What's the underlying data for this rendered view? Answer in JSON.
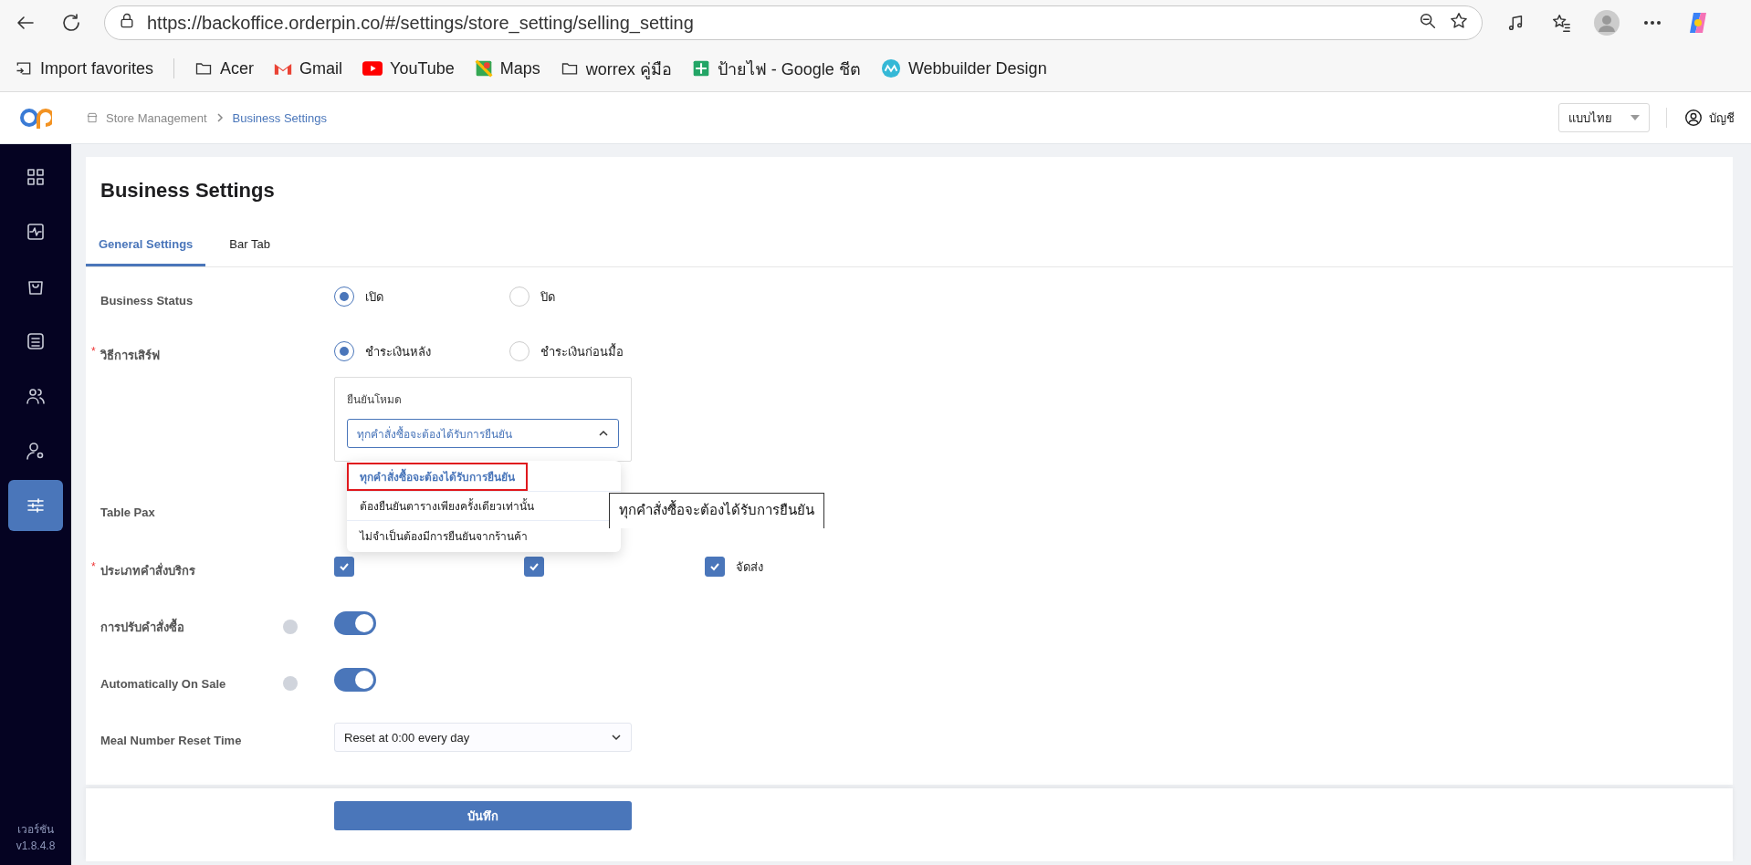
{
  "browser": {
    "url": "https://backoffice.orderpin.co/#/settings/store_setting/selling_setting",
    "bookmarks": [
      {
        "label": "Import favorites",
        "kind": "import"
      },
      {
        "label": "Acer",
        "kind": "folder"
      },
      {
        "label": "Gmail",
        "kind": "mail"
      },
      {
        "label": "YouTube",
        "kind": "video"
      },
      {
        "label": "Maps",
        "kind": "map"
      },
      {
        "label": "worrex คู่มือ",
        "kind": "folder"
      },
      {
        "label": "ป้ายไฟ - Google ชีต",
        "kind": "sheet"
      },
      {
        "label": "Webbuilder Design",
        "kind": "wave"
      }
    ]
  },
  "header": {
    "breadcrumb": [
      {
        "label": "Store Management",
        "selected": false
      },
      {
        "label": "Business Settings",
        "selected": true
      }
    ],
    "language": "แบบไทย",
    "account": "บัญชี"
  },
  "sidebar": {
    "items": [
      {
        "kind": "grid",
        "selected": false
      },
      {
        "kind": "pulse",
        "selected": false
      },
      {
        "kind": "bag",
        "selected": false
      },
      {
        "kind": "store",
        "selected": false
      },
      {
        "kind": "users",
        "selected": false
      },
      {
        "kind": "user-gear",
        "selected": false
      },
      {
        "kind": "sliders",
        "selected": true
      }
    ],
    "version_label": "เวอร์ชัน",
    "version": "v1.8.4.8"
  },
  "page": {
    "title": "Business Settings",
    "tabs": [
      {
        "label": "General Settings",
        "selected": true
      },
      {
        "label": "Bar Tab",
        "selected": false
      }
    ]
  },
  "form": [
    {
      "kind": "radio",
      "label": "Business Status",
      "options": [
        {
          "label": "เปิด",
          "selected": true
        },
        {
          "label": "ปิด",
          "selected": false
        }
      ]
    },
    {
      "kind": "radio",
      "label": "วิธีการเสิร์ฟ",
      "required_mark": "*",
      "options": [
        {
          "label": "ชำระเงินหลัง",
          "selected": true
        },
        {
          "label": "ชำระเงินก่อนมื้อ",
          "selected": false
        }
      ],
      "confirm_mode": {
        "label": "ยืนยันโหมด",
        "value": "ทุกคำสั่งซื้อจะต้องได้รับการยืนยัน",
        "expanded": true,
        "options": [
          {
            "label": "ทุกคำสั่งซื้อจะต้องได้รับการยืนยัน",
            "selected": true,
            "annotated": true
          },
          {
            "label": "ต้องยืนยันตารางเพียงครั้งเดียวเท่านั้น",
            "selected": false,
            "annotated": false
          },
          {
            "label": "ไม่จำเป็นต้องมีการยืนยันจากร้านค้า",
            "selected": false,
            "annotated": false
          }
        ],
        "tooltip": "ทุกคำสั่งซื้อจะต้องได้รับการยืนยัน"
      }
    },
    {
      "kind": "covered",
      "label": "Table Pax"
    },
    {
      "kind": "checkbox",
      "label": "ประเภทคำสั่งบริกร",
      "required_mark": "*",
      "options": [
        {
          "checked": true
        },
        {
          "checked": true
        },
        {
          "label": "จัดส่ง",
          "checked": true
        }
      ]
    },
    {
      "kind": "switch",
      "label": "การปรับคำสั่งซื้อ",
      "help": true,
      "on": true
    },
    {
      "kind": "switch",
      "label": "Automatically On Sale",
      "help": true,
      "on": true
    },
    {
      "kind": "select",
      "label": "Meal Number Reset Time",
      "value": "Reset at 0:00 every day"
    }
  ],
  "save_button": "บันทึก"
}
